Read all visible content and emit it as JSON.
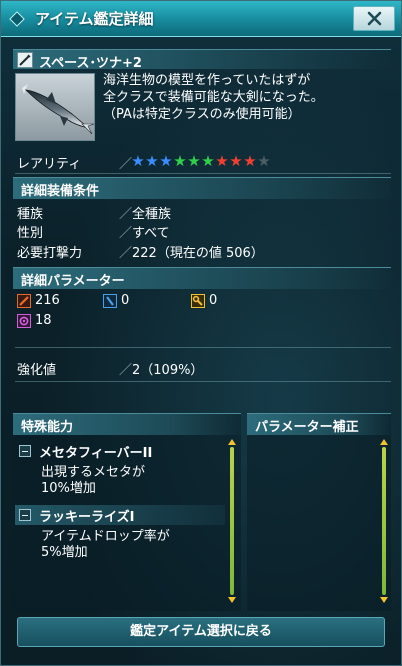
{
  "window": {
    "title": "アイテム鑑定詳細"
  },
  "item": {
    "name": "スペース･ツナ+2",
    "description": [
      "海洋生物の模型を作っていたはずが",
      "全クラスで装備可能な大剣になった。",
      "（PAは特定クラスのみ使用可能）"
    ]
  },
  "rarity": {
    "label": "レアリティ",
    "separator": "／",
    "stars": [
      {
        "color": "#3a8cff",
        "filled": true
      },
      {
        "color": "#3a8cff",
        "filled": true
      },
      {
        "color": "#3a8cff",
        "filled": true
      },
      {
        "color": "#2fd14b",
        "filled": true
      },
      {
        "color": "#2fd14b",
        "filled": true
      },
      {
        "color": "#2fd14b",
        "filled": true
      },
      {
        "color": "#f04030",
        "filled": true
      },
      {
        "color": "#f04030",
        "filled": true
      },
      {
        "color": "#f04030",
        "filled": true
      },
      {
        "color": "#5b6b70",
        "filled": false
      }
    ]
  },
  "requirements": {
    "header": "詳細装備条件",
    "rows": [
      {
        "label": "種族",
        "sep": "／",
        "value": "全種族"
      },
      {
        "label": "性別",
        "sep": "／",
        "value": "すべて"
      },
      {
        "label": "必要打撃力",
        "sep": "／",
        "value": "222（現在の値 506）"
      }
    ]
  },
  "parameters": {
    "header": "詳細パラメーター",
    "items": [
      {
        "icon": "striking-attack-icon",
        "value": "216",
        "color": "#e86a2a"
      },
      {
        "icon": "ranged-attack-icon",
        "value": "0",
        "color": "#4aa0e8"
      },
      {
        "icon": "technique-attack-icon",
        "value": "0",
        "color": "#f0c030"
      },
      {
        "icon": "dexterity-icon",
        "value": "18",
        "color": "#d060d8"
      }
    ],
    "enhance": {
      "label": "強化値",
      "sep": "／",
      "value": "2（109%）"
    }
  },
  "special_abilities": {
    "header": "特殊能力",
    "items": [
      {
        "title": "メセタフィーバーII",
        "desc": [
          "出現するメセタが",
          "10%増加"
        ]
      },
      {
        "title": "ラッキーライズI",
        "desc": [
          "アイテムドロップ率が",
          "5%増加"
        ]
      }
    ]
  },
  "param_correction": {
    "header": "パラメーター補正"
  },
  "footer": {
    "back_label": "鑑定アイテム選択に戻る"
  },
  "colors": {
    "accent": "#1fa2b5",
    "scroll": "#f2c230"
  }
}
